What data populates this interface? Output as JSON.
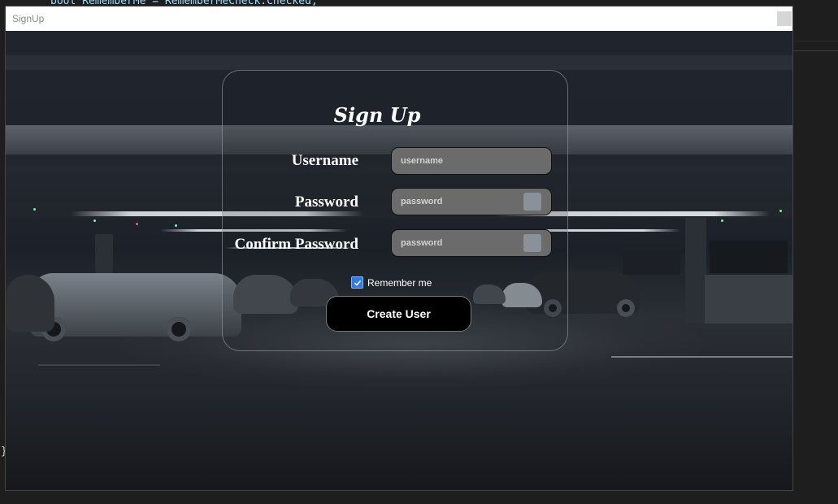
{
  "editor": {
    "code_line": "bool RememberMe = RememberMeCheck.Checked;",
    "closing_brace": "}"
  },
  "window": {
    "title": "SignUp"
  },
  "form": {
    "heading": "Sign Up",
    "username_label": "Username",
    "username_placeholder": "username",
    "password_label": "Password",
    "password_placeholder": "password",
    "confirm_label": "Confirm Password",
    "confirm_placeholder": "password",
    "remember_label": "Remember me",
    "remember_checked": true,
    "create_button": "Create User"
  },
  "colors": {
    "input_bg": "#6b6b6b",
    "checkbox_accent": "#2f7be8",
    "button_bg": "#000000"
  }
}
